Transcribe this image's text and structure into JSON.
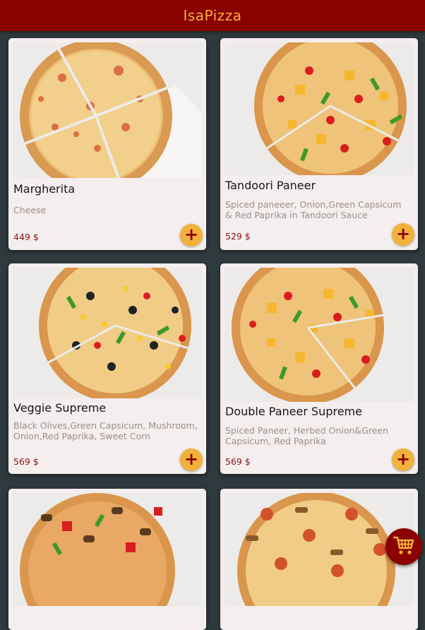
{
  "app": {
    "title": "IsaPizza"
  },
  "currency": "$",
  "products": [
    {
      "name": "Margherita",
      "description": "Cheese",
      "price": "449 $",
      "add_icon": "+"
    },
    {
      "name": "Tandoori Paneer",
      "description": "Spiced paneeer, Onion,Green Capsicum & Red Paprika in Tandoori Sauce",
      "price": "529 $",
      "add_icon": "+"
    },
    {
      "name": "Veggie Supreme",
      "description": "Black Olives,Green Capsicum, Mushroom, Onion,Red Paprika, Sweet Corn",
      "price": "569 $",
      "add_icon": "+"
    },
    {
      "name": "Double Paneer Supreme",
      "description": "Spiced Paneer, Herbed Onion&Green Capsicum, Red Paprika",
      "price": "569 $",
      "add_icon": "+"
    },
    {
      "name": "",
      "description": "",
      "price": "",
      "add_icon": ""
    },
    {
      "name": "",
      "description": "",
      "price": "",
      "add_icon": ""
    }
  ],
  "colors": {
    "header": "#8b0000",
    "accent": "#f1b23c",
    "background": "#2f3a3e",
    "card": "#f4eeee",
    "price": "#8b1212"
  },
  "icons": {
    "add": "plus-icon",
    "cart": "shopping-cart-icon"
  }
}
